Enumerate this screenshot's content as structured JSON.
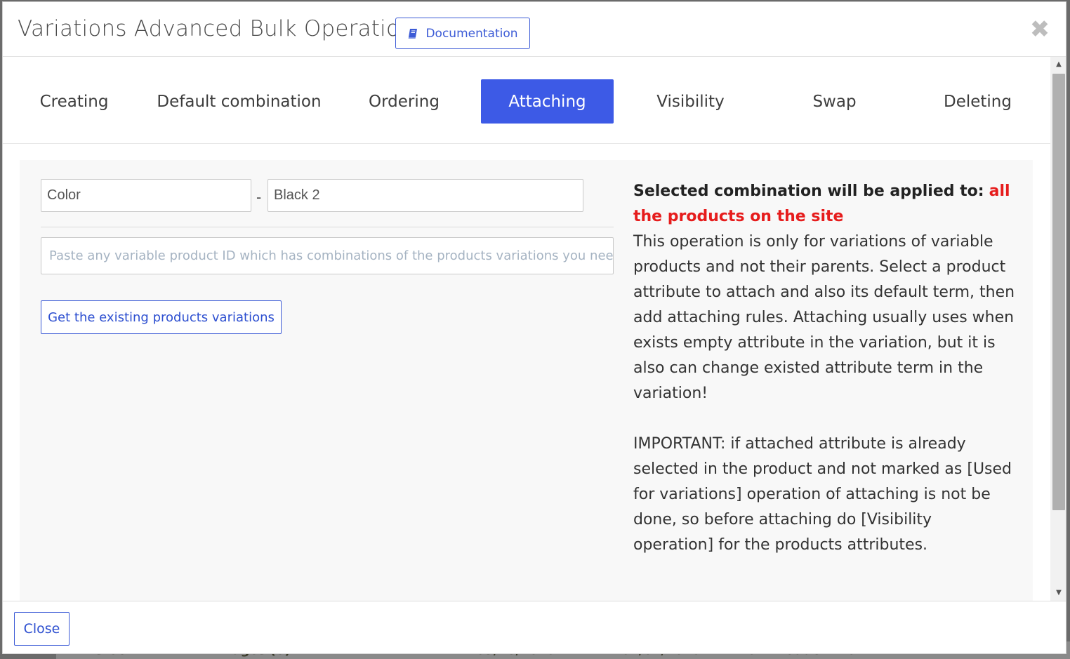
{
  "modal": {
    "title": "Variations Advanced Bulk Operations -",
    "documentation_label": "Documentation",
    "close_glyph": "✖"
  },
  "tabs": [
    {
      "label": "Creating",
      "active": false
    },
    {
      "label": "Default combination",
      "active": false
    },
    {
      "label": "Ordering",
      "active": false
    },
    {
      "label": "Attaching",
      "active": true
    },
    {
      "label": "Visibility",
      "active": false
    },
    {
      "label": "Swap",
      "active": false
    },
    {
      "label": "Deleting",
      "active": false
    }
  ],
  "form": {
    "attribute_value": "Color",
    "separator": "-",
    "term_value": "Black 2",
    "paste_placeholder": "Paste any variable product ID which has combinations of the products variations you nee",
    "get_button_label": "Get the existing products variations"
  },
  "info": {
    "applied_prefix": "Selected combination will be applied to:",
    "applied_target": "all the products on the site",
    "description": "This operation is only for variations of variable products and not their parents. Select a product attribute to attach and also its default term, then add attaching rules. Attaching usually uses when exists empty attribute in the variation, but it is also can change existed attribute term in the variation!",
    "important": "IMPORTANT: if attached attribute is already selected in the product and not marked as [Used for variations] operation of attaching is not be done, so before attaching do [Visibility operation] for the products attributes."
  },
  "footer": {
    "close_label": "Close"
  },
  "background_row": {
    "cells": [
      "In stock",
      "Images (0)",
      "03/18/2025",
      "04/01/2025",
      "#2452 Product 2452"
    ]
  },
  "colors": {
    "accent": "#3d5ae6",
    "highlight_red": "#e61c1c"
  }
}
